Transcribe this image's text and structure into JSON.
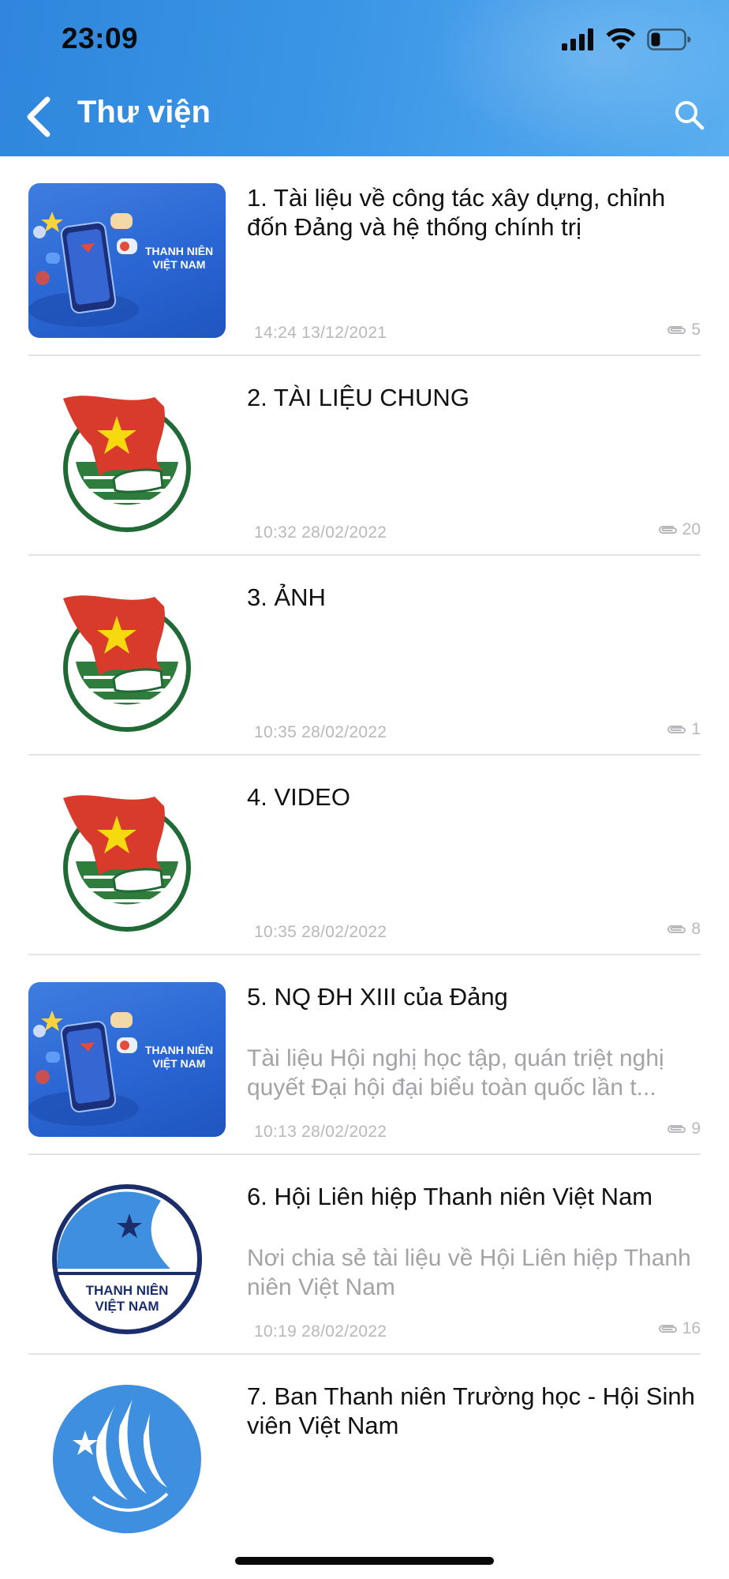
{
  "status_bar": {
    "time": "23:09"
  },
  "nav": {
    "title": "Thư viện"
  },
  "items": [
    {
      "title": "1. Tài liệu về công tác xây dựng, chỉnh đốn Đảng và hệ thống chính trị",
      "description": "",
      "date": "14:24 13/12/2021",
      "count": "5",
      "thumb": "thanh-nien-viet-nam-phone-banner",
      "thumb_text": [
        "THANH NIÊN",
        "VIỆT NAM"
      ]
    },
    {
      "title": "2. TÀI LIỆU CHUNG",
      "description": "",
      "date": "10:32 28/02/2022",
      "count": "20",
      "thumb": "doan-thanh-nien-emblem"
    },
    {
      "title": "3. ẢNH",
      "description": "",
      "date": "10:35 28/02/2022",
      "count": "1",
      "thumb": "doan-thanh-nien-emblem"
    },
    {
      "title": "4. VIDEO",
      "description": "",
      "date": "10:35 28/02/2022",
      "count": "8",
      "thumb": "doan-thanh-nien-emblem"
    },
    {
      "title": "5. NQ ĐH XIII của Đảng",
      "description": "Tài liệu Hội nghị học tập, quán triệt nghị quyết Đại hội đại biểu toàn quốc lần t...",
      "date": "10:13 28/02/2022",
      "count": "9",
      "thumb": "thanh-nien-viet-nam-phone-banner",
      "thumb_text": [
        "THANH NIÊN",
        "VIỆT NAM"
      ]
    },
    {
      "title": "6. Hội Liên hiệp Thanh niên Việt Nam",
      "description": "Nơi chia sẻ tài liệu về Hội Liên hiệp Thanh niên Việt Nam",
      "date": "10:19 28/02/2022",
      "count": "16",
      "thumb": "hoi-lien-hiep-emblem",
      "thumb_text": [
        "THANH NIÊN",
        "VIỆT NAM"
      ]
    },
    {
      "title": "7. Ban Thanh niên Trường học - Hội Sinh viên Việt Nam",
      "description": "",
      "date": "",
      "count": "",
      "thumb": "hoi-sinh-vien-emblem"
    }
  ],
  "colors": {
    "header_blue": "#3b95e6",
    "emblem_red": "#d83a2b",
    "star_yellow": "#f7d90f",
    "emblem_green": "#2e7d3d",
    "hlh_blue": "#3f8fe0",
    "muted_text": "#a3a3a8"
  }
}
